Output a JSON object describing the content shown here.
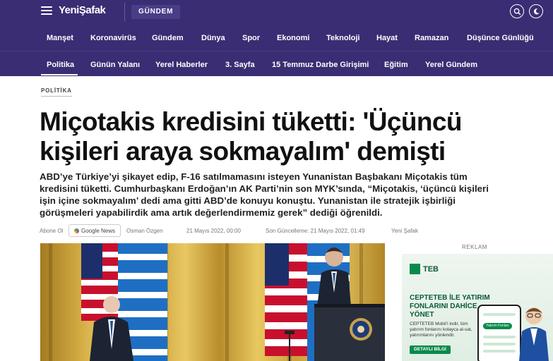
{
  "header": {
    "logo": "YeniŞafak",
    "section": "GÜNDEM",
    "search_icon": "search-icon",
    "moon_icon": "moon-icon"
  },
  "nav_primary": {
    "items": [
      {
        "label": "Manşet"
      },
      {
        "label": "Koronavirüs"
      },
      {
        "label": "Gündem",
        "active": true
      },
      {
        "label": "Dünya"
      },
      {
        "label": "Spor"
      },
      {
        "label": "Ekonomi"
      },
      {
        "label": "Teknoloji"
      },
      {
        "label": "Hayat"
      },
      {
        "label": "Ramazan"
      },
      {
        "label": "Düşünce Günlüğü"
      }
    ]
  },
  "nav_secondary": {
    "items": [
      {
        "label": "Politika",
        "active": true
      },
      {
        "label": "Günün Yalanı"
      },
      {
        "label": "Yerel Haberler"
      },
      {
        "label": "3. Sayfa"
      },
      {
        "label": "15 Temmuz Darbe Girişimi"
      },
      {
        "label": "Eğitim"
      },
      {
        "label": "Yerel Gündem"
      }
    ]
  },
  "article": {
    "category": "POLİTİKA",
    "title": "Miçotakis kredisini tüketti: 'Üçüncü kişileri araya sokmayalım' demişti",
    "summary": "ABD’ye Türkiye’yi şikayet edip, F-16 satılmamasını isteyen Yunanistan Başbakanı Miçotakis tüm kredisini tüketti. Cumhurbaşkanı Erdoğan’ın AK Parti’nin son MYK’sında, “Miçotakis, ‘üçüncü kişileri işin içine sokmayalım’ dedi ama gitti ABD’de konuyu konuştu. Yunanistan ile stratejik işbirliği görüşmeleri yapabilirdik ama artık değerlendirmemiz gerek” dediği öğrenildi.",
    "meta": {
      "follow": "Abone Ol",
      "google_news": "Google News",
      "author": "Osman Özgen",
      "published": "21 Mayıs 2022, 00:00",
      "updated": "Son Güncelleme: 21 Mayıs 2022, 01:49",
      "source": "Yeni Şafak"
    }
  },
  "ad": {
    "label": "REKLAM",
    "brand": "TEB",
    "headline": "CEPTETEB İLE YATIRIM FONLARINI DAHİCE YÖNET",
    "body": "CEPTETEB Mobil’i indir, tüm yatırım fonlarını kolayca al-sat, yatırımlarını yönlendir.",
    "cta": "DETAYLI BİLGİ",
    "phone_tag": "Yatırım Fonları"
  },
  "colors": {
    "header_bg": "#3a2d73",
    "accent_green": "#0a8a4a"
  }
}
